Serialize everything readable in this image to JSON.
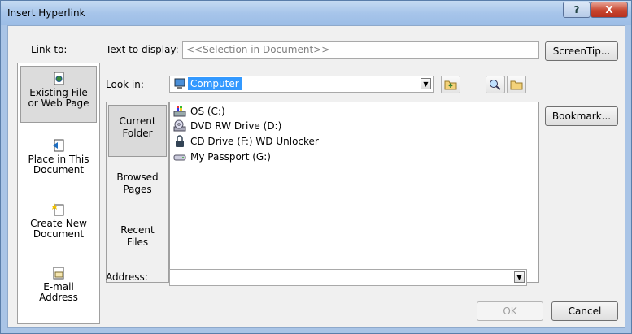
{
  "window": {
    "title": "Insert Hyperlink"
  },
  "titlebar": {
    "help_glyph": "?",
    "close_glyph": "X"
  },
  "link_to": {
    "label": "Link to:",
    "items": [
      {
        "line1": "Existing File",
        "line2": "or Web Page",
        "icon": "existing-file-icon"
      },
      {
        "line1": "Place in This",
        "line2": "Document",
        "icon": "place-in-document-icon"
      },
      {
        "line1": "Create New",
        "line2": "Document",
        "icon": "create-document-icon"
      },
      {
        "line1": "E-mail",
        "line2": "Address",
        "icon": "email-address-icon"
      }
    ]
  },
  "text_to_display": {
    "label": "Text to display:",
    "value": "<<Selection in Document>>"
  },
  "screentip_button": "ScreenTip...",
  "look_in": {
    "label": "Look in:",
    "value": "Computer"
  },
  "bookmark_button": "Bookmark...",
  "browse_sidebar": [
    {
      "line1": "Current",
      "line2": "Folder"
    },
    {
      "line1": "Browsed",
      "line2": "Pages"
    },
    {
      "line1": "Recent",
      "line2": "Files"
    }
  ],
  "files": [
    {
      "name": "OS (C:)",
      "icon": "os-drive-icon"
    },
    {
      "name": "DVD RW Drive (D:)",
      "icon": "dvd-drive-icon"
    },
    {
      "name": "CD Drive (F:) WD Unlocker",
      "icon": "cd-drive-icon"
    },
    {
      "name": "My Passport (G:)",
      "icon": "external-drive-icon"
    }
  ],
  "address": {
    "label": "Address:",
    "value": ""
  },
  "ok_button": "OK",
  "cancel_button": "Cancel"
}
